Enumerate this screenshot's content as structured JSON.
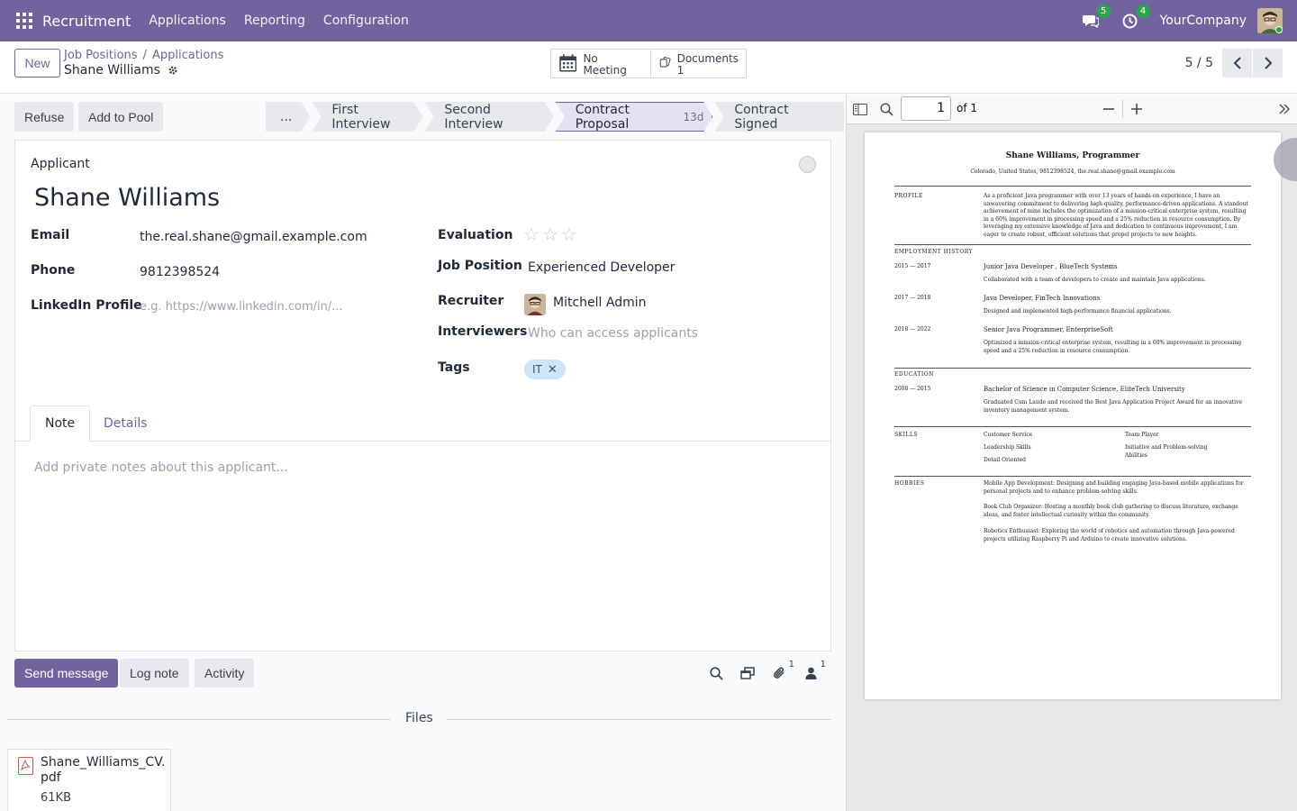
{
  "navbar": {
    "app_name": "Recruitment",
    "menus": [
      "Applications",
      "Reporting",
      "Configuration"
    ],
    "messages_count": "5",
    "activities_count": "4",
    "company": "YourCompany"
  },
  "control_panel": {
    "new_label": "New",
    "breadcrumb": [
      "Job Positions",
      "Applications"
    ],
    "record_name": "Shane Williams",
    "smart_buttons": {
      "meeting": {
        "label": "No Meeting"
      },
      "documents": {
        "label": "Documents",
        "count": "1"
      }
    },
    "pager": "5 / 5"
  },
  "statusbar": {
    "refuse_label": "Refuse",
    "add_to_pool_label": "Add to Pool",
    "stages": [
      {
        "label": "..."
      },
      {
        "label": "First Interview"
      },
      {
        "label": "Second Interview"
      },
      {
        "label": "Contract Proposal",
        "days": "13d",
        "active": true
      },
      {
        "label": "Contract Signed"
      }
    ]
  },
  "form": {
    "applicant_label": "Applicant",
    "name": "Shane Williams",
    "email": {
      "label": "Email",
      "value": "the.real.shane@gmail.example.com"
    },
    "phone": {
      "label": "Phone",
      "value": "9812398524"
    },
    "linkedin": {
      "label": "LinkedIn Profile",
      "placeholder": "e.g. https://www.linkedin.com/in/..."
    },
    "evaluation": {
      "label": "Evaluation",
      "stars": 0,
      "max_stars": 3
    },
    "job_position": {
      "label": "Job Position",
      "value": "Experienced Developer"
    },
    "recruiter": {
      "label": "Recruiter",
      "value": "Mitchell Admin"
    },
    "interviewers": {
      "label": "Interviewers",
      "placeholder": "Who can access applicants"
    },
    "tags": {
      "label": "Tags",
      "items": [
        "IT"
      ]
    },
    "tabs": [
      {
        "label": "Note"
      },
      {
        "label": "Details"
      }
    ],
    "note_placeholder": "Add private notes about this applicant..."
  },
  "chatter": {
    "send_message_label": "Send message",
    "log_note_label": "Log note",
    "activity_label": "Activity",
    "attachments_count": "1",
    "followers_count": "1",
    "files_label": "Files",
    "file": {
      "name": "Shane_Williams_CV.pdf",
      "size": "61KB"
    }
  },
  "pdf_viewer": {
    "page_number": "1",
    "page_total": "of 1",
    "page": {
      "title": "Shane Williams, Programmer",
      "subtitle": "Colorado, United States, 9812398524, the.real.shane@gmail.example.com",
      "profile_heading": "PROFILE",
      "profile_text": "As a proficient Java programmer with over 13 years of hands-on experience, I have an unwavering commitment to delivering high-quality, performance-driven applications. A standout achievement of mine includes the optimization of a mission-critical enterprise system, resulting in a 60% improvement in processing speed and a 25% reduction in resource consumption. By leveraging my extensive knowledge of Java and dedication to continuous improvement, I am eager to create robust, efficient solutions that propel projects to new heights.",
      "employment_heading": "EMPLOYMENT HISTORY",
      "jobs": [
        {
          "dates": "2015 — 2017",
          "title": "Junior Java Developer , BlueTech Systems",
          "desc": "Collaborated with a team of developers to create and maintain Java applications."
        },
        {
          "dates": "2017 — 2018",
          "title": "Java Developer, FinTech Innovations",
          "desc": "Designed and implemented high-performance financial applications."
        },
        {
          "dates": "2018 — 2022",
          "title": "Senior Java Programmer, EnterpriseSoft",
          "desc": "Optimized a mission-critical enterprise system, resulting in a 60% improvement in processing speed and a 25% reduction in resource consumption."
        }
      ],
      "education_heading": "EDUCATION",
      "education": {
        "dates": "2008 — 2015",
        "title": "Bachelor of Science in Computer Science, EliteTech University",
        "desc": "Graduated Cum Laude and received the Best Java Application Project Award for an innovative inventory management system."
      },
      "skills_heading": "SKILLS",
      "skills": [
        "Customer Service",
        "Team Player",
        "Leadership Skills",
        "Initiative and Problem-solving Abilities",
        "Detail Oriented"
      ],
      "hobbies_heading": "HOBBIES",
      "hobbies": [
        "Mobile App Development: Designing and building engaging Java-based mobile applications for personal projects and to enhance problem-solving skills.",
        "Book Club Organizer: Hosting a monthly book club gathering to discuss literature, exchange ideas, and foster intellectual curiosity within the community.",
        "Robotics Enthusiast: Exploring the world of robotics and automation through Java-powered projects utilizing Raspberry Pi and Arduino to create innovative solutions."
      ]
    }
  },
  "colors": {
    "brand": "#71639e",
    "success": "#28a745",
    "tag_bg": "#cfe4f5"
  }
}
